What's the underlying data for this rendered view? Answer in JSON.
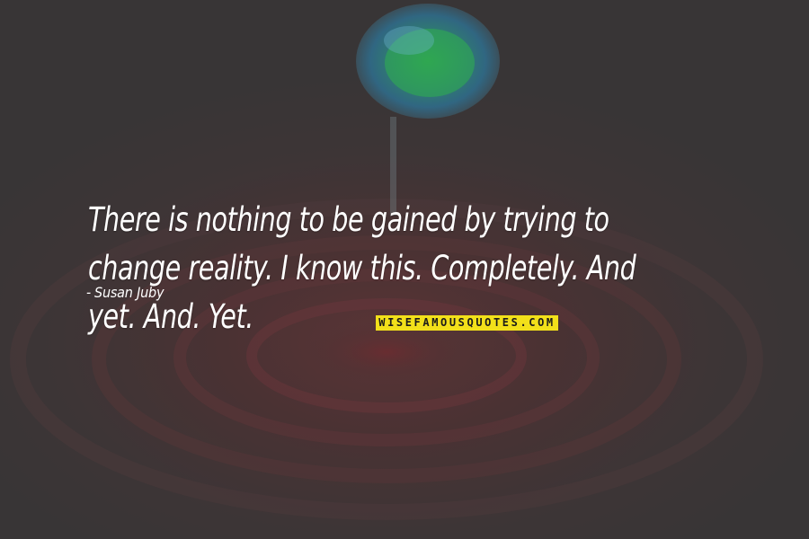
{
  "quote": {
    "text": "There is nothing to be gained by trying to change reality. I know this. Completely. And yet. And. Yet.",
    "author_dash": "-",
    "author": "Susan Juby"
  },
  "watermark": {
    "text": "WISEFAMOUSQUOTES.COM",
    "background_color": "#f2e01a"
  },
  "background": {
    "subject": "water-drop-ripple-image",
    "colors": [
      "#3a3535",
      "#5a3436",
      "#2f8fb0",
      "#2fae5a"
    ]
  }
}
